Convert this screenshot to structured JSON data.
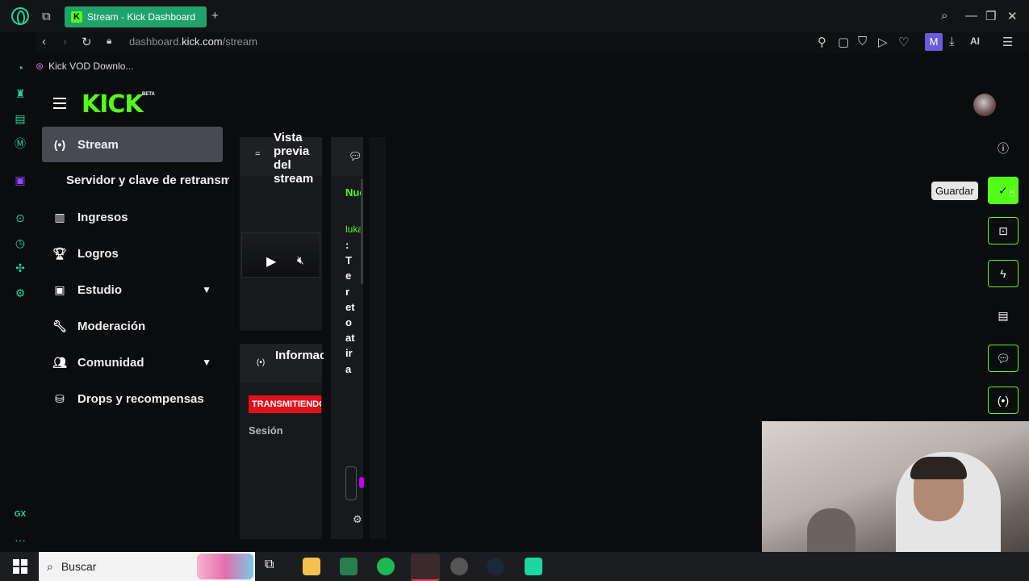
{
  "browser": {
    "tab_title": "Stream - Kick Dashboard",
    "tab_close": "✕",
    "new_tab": "+",
    "url_prefix": "dashboard.",
    "url_domain": "kick.com",
    "url_path": "/stream",
    "bookmark": "Kick VOD Downlo...",
    "ai_label": "AI",
    "profile_initial": "M",
    "sidebar_gx": "GX",
    "sidebar_more": "···"
  },
  "header": {
    "logo": "KICK",
    "beta": "BETA"
  },
  "nav": {
    "items": [
      {
        "label": "Stream"
      },
      {
        "label": "Servidor y clave de retransmisión"
      },
      {
        "label": "Ingresos"
      },
      {
        "label": "Logros"
      },
      {
        "label": "Estudio"
      },
      {
        "label": "Moderación"
      },
      {
        "label": "Comunidad"
      },
      {
        "label": "Drops y recompensas"
      }
    ]
  },
  "panels": {
    "preview_title": "Vista previa del stream",
    "info_title": "Información de la sesión",
    "status_badge": "TRANSMITIENDO",
    "session_label": "Sesión",
    "chat_new": "Nuevos mensajes",
    "chat_user": "lukas",
    "chat_message": ": Tereto atira"
  },
  "rail": {
    "tooltip": "Guardar"
  },
  "taskbar": {
    "search_placeholder": "Buscar"
  },
  "colors": {
    "kick_green": "#53fc18",
    "opera_accent": "#1fd6a0",
    "live_red": "#e0111b"
  }
}
